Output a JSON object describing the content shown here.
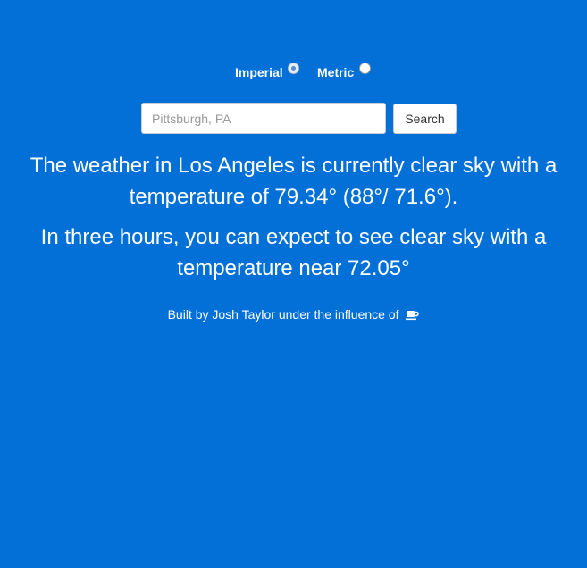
{
  "units": {
    "imperial_label": "Imperial",
    "metric_label": "Metric",
    "selected": "imperial"
  },
  "search": {
    "placeholder": "Pittsburgh, PA",
    "value": "",
    "button_label": "Search"
  },
  "weather": {
    "current_line_1": "The weather in Los Angeles is currently clear sky with a",
    "current_line_2": "temperature of 79.34° (88°/ 71.6°).",
    "forecast_line_1": "In three hours, you can expect to see clear sky with a",
    "forecast_line_2": "temperature near 72.05°"
  },
  "footer": {
    "text": "Built by Josh Taylor under the influence of",
    "icon": "coffee-icon"
  },
  "colors": {
    "background": "#0270D7",
    "text": "#ffffff"
  }
}
